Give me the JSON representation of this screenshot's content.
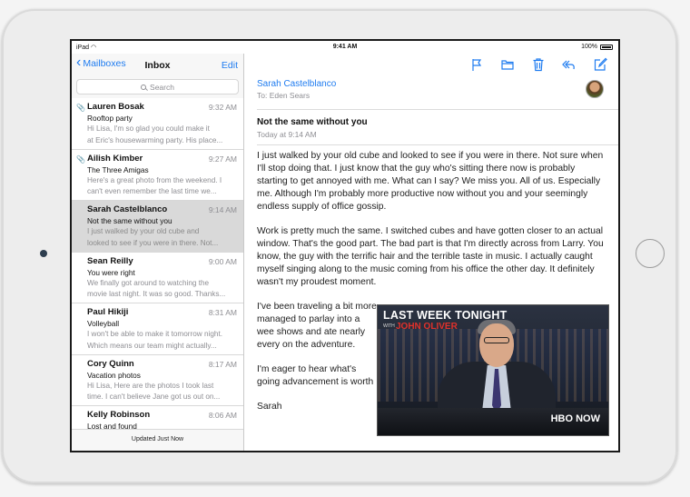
{
  "status_bar": {
    "carrier": "iPad",
    "time": "9:41 AM",
    "battery": "100%"
  },
  "mailbox_nav": {
    "back_label": "Mailboxes",
    "title": "Inbox",
    "edit_label": "Edit"
  },
  "search": {
    "placeholder": "Search"
  },
  "messages": [
    {
      "sender": "Lauren Bosak",
      "time": "9:32 AM",
      "subject": "Rooftop party",
      "preview1": "Hi Lisa, I'm so glad you could make it",
      "preview2": "at Eric's housewarming party. His place...",
      "attachment": true,
      "selected": false
    },
    {
      "sender": "Ailish Kimber",
      "time": "9:27 AM",
      "subject": "The Three Amigas",
      "preview1": "Here's a great photo from the weekend. I",
      "preview2": "can't even remember the last time we...",
      "attachment": true,
      "selected": false
    },
    {
      "sender": "Sarah Castelblanco",
      "time": "9:14 AM",
      "subject": "Not the same without you",
      "preview1": "I just walked by your old cube and",
      "preview2": "looked to see if you were in there. Not...",
      "attachment": false,
      "selected": true
    },
    {
      "sender": "Sean Reilly",
      "time": "9:00 AM",
      "subject": "You were right",
      "preview1": "We finally got around to watching the",
      "preview2": "movie last night. It was so good. Thanks...",
      "attachment": false,
      "selected": false
    },
    {
      "sender": "Paul Hikiji",
      "time": "8:31 AM",
      "subject": "Volleyball",
      "preview1": "I won't be able to make it tomorrow night.",
      "preview2": "Which means our team might actually...",
      "attachment": false,
      "selected": false
    },
    {
      "sender": "Cory Quinn",
      "time": "8:17 AM",
      "subject": "Vacation photos",
      "preview1": "Hi Lisa, Here are the photos I took last",
      "preview2": "time. I can't believe Jane got us out on...",
      "attachment": false,
      "selected": false
    },
    {
      "sender": "Kelly Robinson",
      "time": "8:06 AM",
      "subject": "Lost and found",
      "preview1": "",
      "preview2": "",
      "attachment": false,
      "selected": false
    }
  ],
  "list_footer": "Updated Just Now",
  "toolbar": {
    "icons": [
      "flag-icon",
      "folder-icon",
      "trash-icon",
      "reply-icon",
      "compose-icon"
    ],
    "accent": "#1f7cf0"
  },
  "email": {
    "from": "Sarah Castelblanco",
    "to": "To: Eden Sears",
    "subject": "Not the same without you",
    "date": "Today at 9:14 AM",
    "paragraphs": [
      "I just walked by your old cube and looked to see if you were in there. Not sure when I'll stop doing that. I just know that the guy who's sitting there now is probably starting to get annoyed with me. What can I say? We miss you. All of us. Especially me. Although I'm probably more productive now without you and your seemingly endless supply of office gossip.",
      "Work is pretty much the same. I switched cubes and have gotten closer to an actual window. That's the good part. The bad part is that I'm directly across from Larry. You know, the guy with the terrific hair and the terrible taste in music. I actually caught myself singing along to the music coming from his office the other day. It definitely wasn't my proudest moment.",
      "I've been traveling a bit more managed to parlay into a wee shows and ate nearly every on the adventure. You'd have lov",
      "I'm eager to hear what's going advancement is worth not be",
      "Sarah"
    ]
  },
  "video": {
    "title": "LAST WEEK TONIGHT",
    "with": "WITH",
    "host": "JOHN OLIVER",
    "network": "HBO NOW"
  }
}
